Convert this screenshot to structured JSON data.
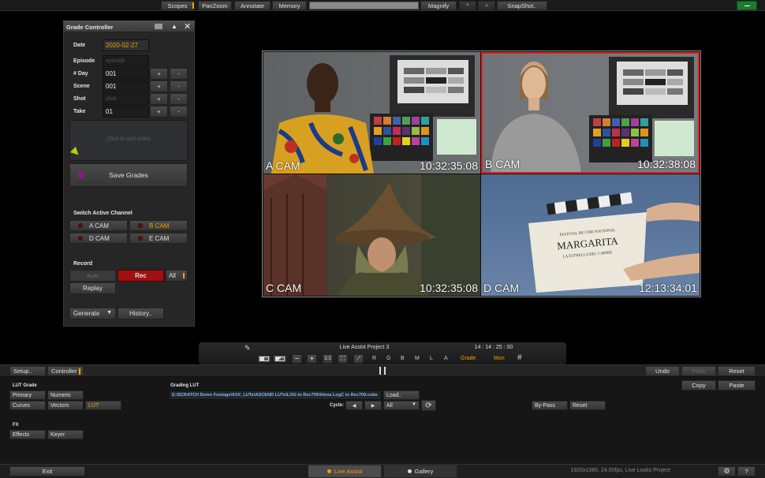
{
  "top_toolbar": {
    "scopes": "Scopes",
    "panzoom": "PanZoom",
    "annotate": "Annotate",
    "memory": "Memory",
    "magnify": "Magnify",
    "snapshot": "SnapShot.."
  },
  "grade_controller": {
    "title": "Grade Controller",
    "date_label": "Date",
    "date_value": "2020-02-27",
    "episode_label": "Episode",
    "episode_placeholder": "episode",
    "day_label": "# Day",
    "day_value": "001",
    "scene_label": "Scene",
    "scene_value": "001",
    "shot_label": "Shot",
    "shot_placeholder": "shot",
    "take_label": "Take",
    "take_value": "01",
    "plus": "+",
    "minus": "-",
    "notes_placeholder": "Click to add notes",
    "save_grades": "Save Grades",
    "switch_channel_title": "Switch Active Channel",
    "channels": [
      "A CAM",
      "B CAM",
      "D CAM",
      "E CAM"
    ],
    "record_title": "Record",
    "auto": "Auto",
    "rec": "Rec",
    "all": "All",
    "replay": "Replay",
    "generate": "Generate",
    "history": "History.."
  },
  "viewer": {
    "cams": [
      {
        "name": "A CAM",
        "timecode": "10:32:35:08"
      },
      {
        "name": "B CAM",
        "timecode": "10:32:38:08"
      },
      {
        "name": "C CAM",
        "timecode": "10:32:35:08"
      },
      {
        "name": "D CAM",
        "timecode": "12:13:34:01"
      }
    ],
    "slate_text_1": "FESTIVAL DE CINE NACIONAL",
    "slate_text_2": "MARGARITA",
    "slate_text_3": "LA ESTRELLA DEL CARIBE"
  },
  "transport": {
    "project": "Live Assist Project 3",
    "timecode": "14 : 14 : 25 : 00",
    "one_to_one": "1:1",
    "channels": [
      "R",
      "G",
      "B",
      "M",
      "L",
      "A"
    ],
    "grade": "Grade",
    "mon": "Mon"
  },
  "bottom_panel": {
    "setup": "Setup..",
    "controller": "Controller",
    "undo": "Undo",
    "redo": "Redo",
    "reset_top": "Reset",
    "copy": "Copy",
    "paste": "Paste",
    "lut_grade_title": "LUT Grade",
    "primary": "Primary",
    "numeric": "Numeric",
    "curves": "Curves",
    "vectors": "Vectors",
    "lut": "LUT",
    "grading_lut_title": "Grading LUT",
    "lut_path": "E:\\SCRATCH Demo Footage\\XXX_LUTs\\ASCEND LUTs\\LOG to Rec709\\Alexa LogC to Rec709.cube",
    "load": "Load..",
    "cycle_label": "Cycle:",
    "cycle_value": "All",
    "bypass": "By-Pass",
    "reset": "Reset",
    "fx_title": "FX",
    "effects": "Effects",
    "keyer": "Keyer"
  },
  "status_bar": {
    "exit": "Exit",
    "live_assist": "Live Assist",
    "gallery": "Gallery",
    "info": "1920x1080, 24.00fps, Live Looks Project",
    "help": "?"
  },
  "colors": {
    "accent_orange": "#f0a000",
    "rec_red": "#a01010",
    "active_cell_border": "#e02020",
    "green_button": "#1e7a2e"
  }
}
